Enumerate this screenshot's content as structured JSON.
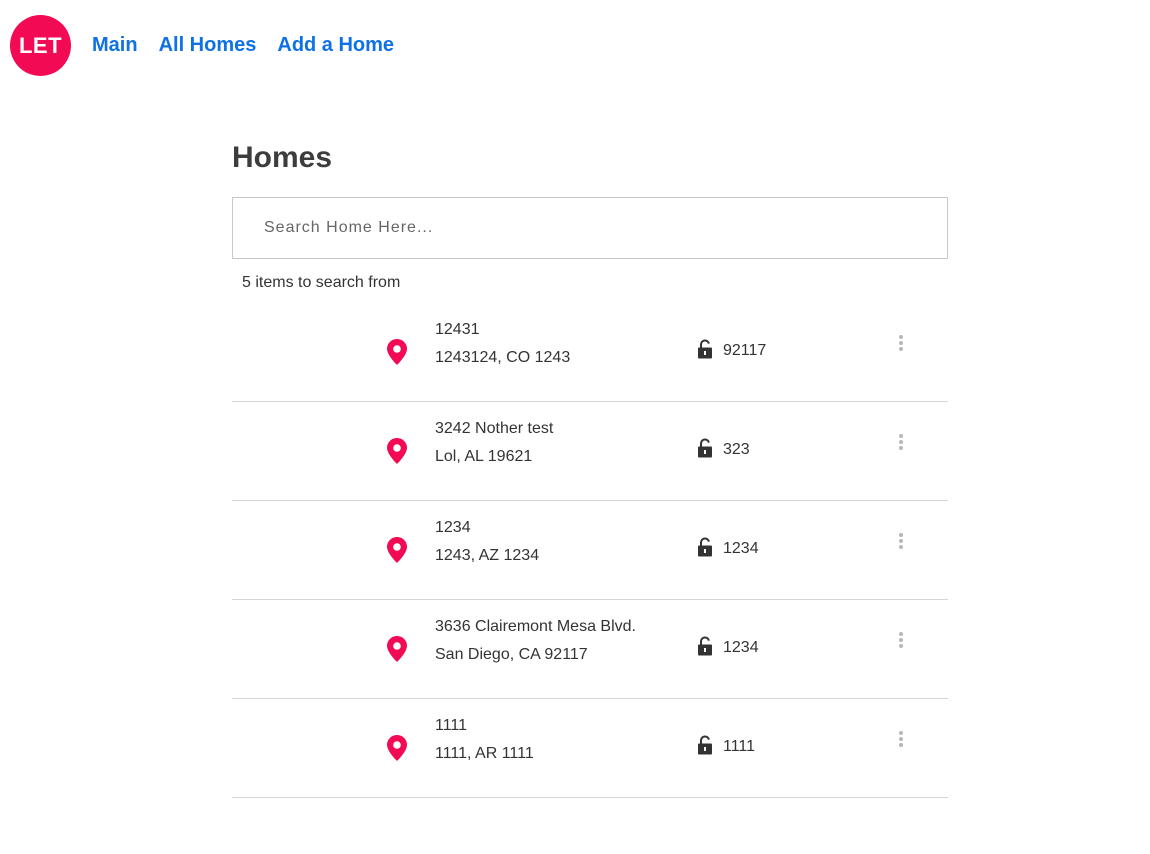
{
  "brand": {
    "logo_text": "LET",
    "color": "#f20a55"
  },
  "nav": {
    "links": [
      "Main",
      "All Homes",
      "Add a Home"
    ],
    "link_color": "#0e71e6"
  },
  "page": {
    "title": "Homes",
    "search_placeholder": "Search Home Here...",
    "count_text": "5 items to search from"
  },
  "homes": [
    {
      "line1": "12431",
      "line2": "1243124, CO 1243",
      "code": "92117"
    },
    {
      "line1": "3242 Nother test",
      "line2": "Lol, AL 19621",
      "code": "323"
    },
    {
      "line1": "1234",
      "line2": "1243, AZ 1234",
      "code": "1234"
    },
    {
      "line1": "3636 Clairemont Mesa Blvd.",
      "line2": "San Diego, CA 92117",
      "code": "1234"
    },
    {
      "line1": "1111",
      "line2": "1111, AR 1111",
      "code": "1111"
    }
  ],
  "icons": {
    "pin": "map-pin-icon",
    "lock": "unlock-icon",
    "more": "more-vertical-icon"
  }
}
